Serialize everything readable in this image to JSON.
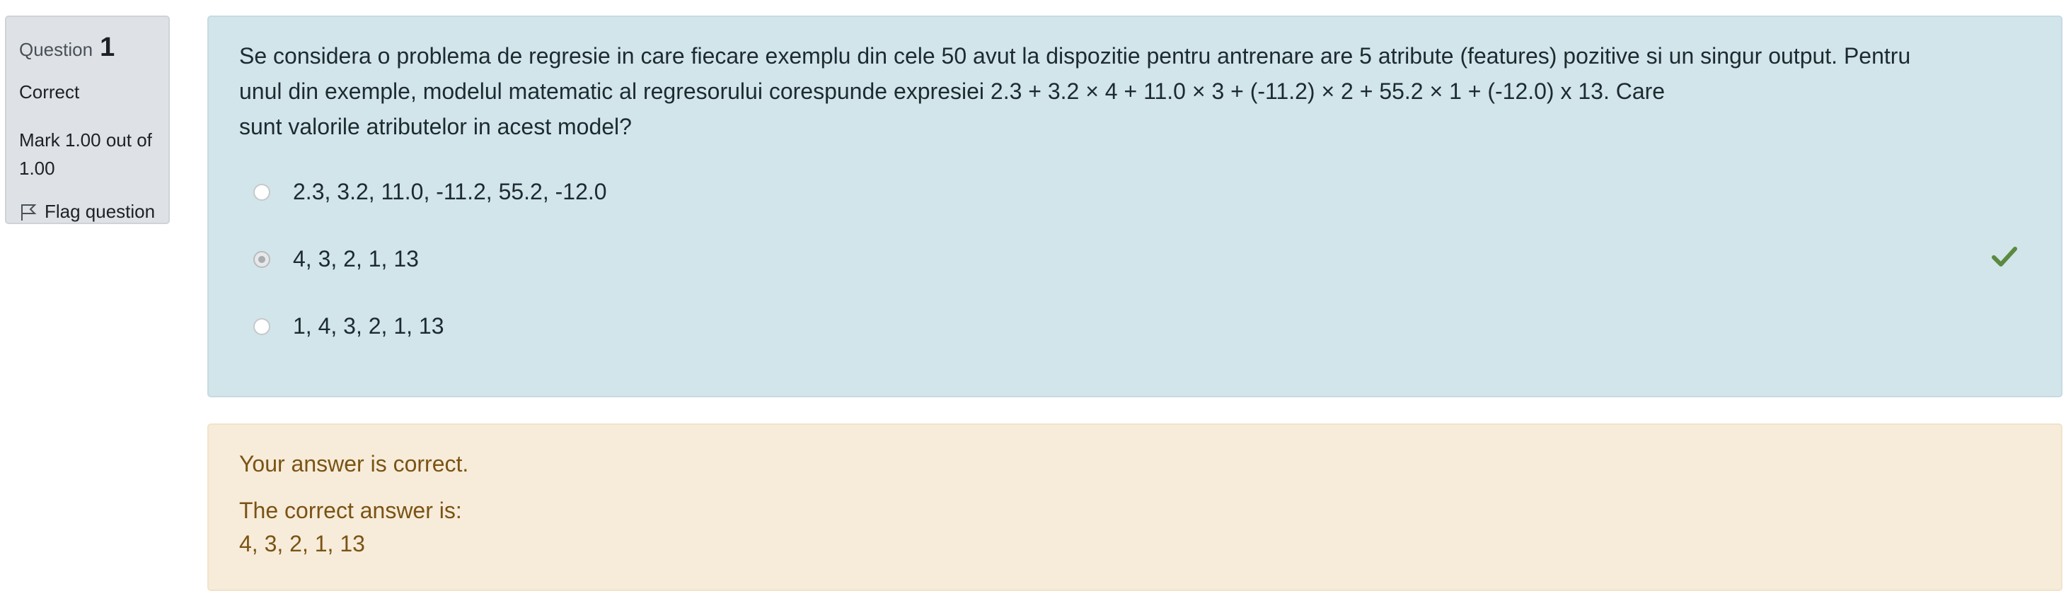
{
  "info": {
    "question_label": "Question",
    "question_number": "1",
    "state": "Correct",
    "grade_line1": "Mark 1.00 out of",
    "grade_line2": "1.00",
    "flag_label": "Flag question",
    "flag_icon": "flag-icon"
  },
  "question": {
    "text_line1": "Se considera o problema de regresie in care fiecare exemplu din cele 50 avut la dispozitie pentru antrenare are 5 atribute (features) pozitive si un singur output. Pentru",
    "text_line2": "unul din exemple, modelul matematic al regresorului corespunde expresiei 2.3 + 3.2 × 4 + 11.0 × 3 + (-11.2) × 2 + 55.2 × 1 + (-12.0) x 13. Care",
    "text_line3": "sunt valorile atributelor in acest model?",
    "answers": [
      {
        "label": "2.3, 3.2, 11.0, -11.2, 55.2, -12.0",
        "selected": false
      },
      {
        "label": "4, 3, 2, 1, 13",
        "selected": true,
        "correct_icon": "check-icon"
      },
      {
        "label": "1, 4, 3, 2, 1, 13",
        "selected": false
      }
    ]
  },
  "feedback": {
    "general": "Your answer is correct.",
    "right_answer_label": "The correct answer is:",
    "right_answer_value": "4, 3, 2, 1, 13"
  },
  "colors": {
    "question_bg": "#d2e5ea",
    "feedback_bg": "#f7ecd9",
    "info_bg": "#dee2e6",
    "check_green": "#5a8a3f",
    "feedback_text": "#7a5315"
  }
}
